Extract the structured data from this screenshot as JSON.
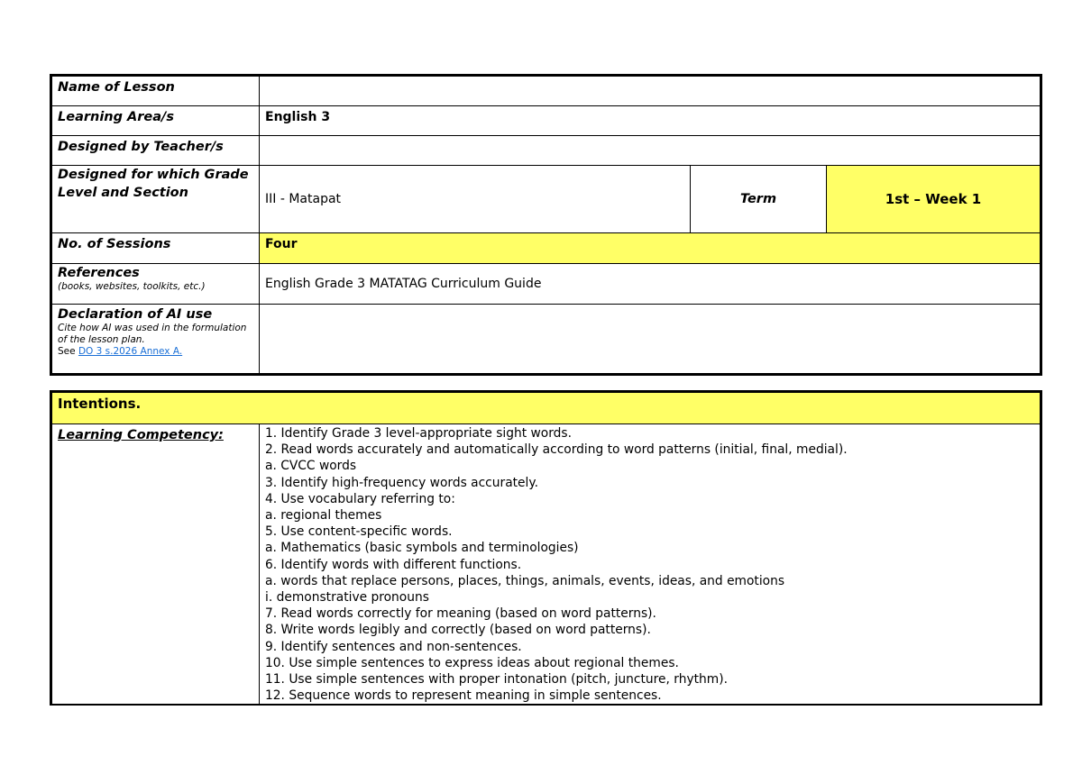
{
  "lesson_info": {
    "name_of_lesson": {
      "label": "Name of Lesson",
      "value": ""
    },
    "learning_area": {
      "label": "Learning Area/s",
      "value": "English 3"
    },
    "designed_by": {
      "label": "Designed by Teacher/s",
      "value": ""
    },
    "grade_level": {
      "label": "Designed for which Grade Level and Section",
      "value": "III - Matapat",
      "term_label": "Term",
      "term_value": "1st – Week 1"
    },
    "sessions": {
      "label": "No. of Sessions",
      "value": "Four"
    },
    "references": {
      "label": "References",
      "sublabel": "(books, websites, toolkits, etc.)",
      "value": "English Grade 3 MATATAG Curriculum Guide"
    },
    "ai_use": {
      "label": "Declaration of AI use",
      "note": "Cite how AI was used in the formulation of the lesson plan.",
      "see": "See ",
      "link_text": "DO 3 s.2026 Annex A.",
      "value": ""
    }
  },
  "intentions": {
    "heading": "Intentions.",
    "competency_label": "Learning Competency:",
    "competencies": [
      "1. Identify Grade 3 level-appropriate sight words.",
      "2. Read words accurately and automatically according to word patterns (initial, final, medial).",
      "a. CVCC words",
      "3. Identify high-frequency words accurately.",
      "4. Use vocabulary referring to:",
      "a. regional themes",
      "5. Use content-specific words.",
      "a. Mathematics (basic symbols and terminologies)",
      "6. Identify words with different functions.",
      "a. words that replace persons, places, things, animals, events, ideas, and emotions",
      "i. demonstrative pronouns",
      "7. Read words correctly for meaning (based on word patterns).",
      "8. Write words legibly and correctly (based on word patterns).",
      "9. Identify sentences and non-sentences.",
      "10. Use simple sentences to express ideas about regional themes.",
      "11. Use simple sentences with proper intonation (pitch, juncture, rhythm).",
      "12. Sequence words to represent meaning in simple sentences."
    ]
  },
  "colors": {
    "highlight": "#ffff66",
    "link": "#1a6fd6"
  }
}
